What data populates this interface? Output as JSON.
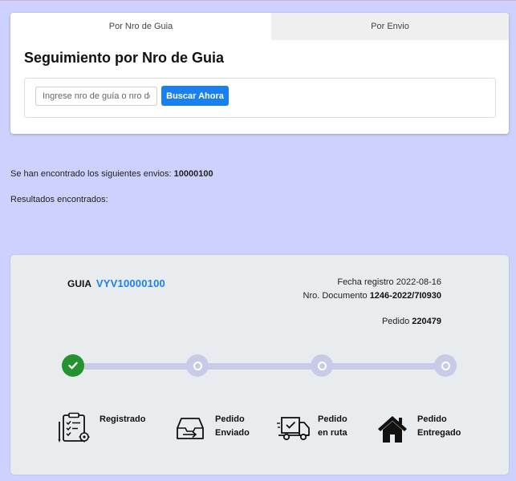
{
  "tabs": [
    {
      "label": "Por Nro de Guia",
      "active": true
    },
    {
      "label": "Por Envio",
      "active": false
    }
  ],
  "search": {
    "title": "Seguimiento por Nro de Guia",
    "placeholder": "Ingrese nro de guía o nro de",
    "value": "",
    "button_label": "Buscar Ahora"
  },
  "results": {
    "found_prefix": "Se han encontrado los siguientes envios:",
    "found_value": "10000100",
    "results_label": "Resultados encontrados:"
  },
  "shipment": {
    "guia_label": "GUIA",
    "guia_number": "VYV10000100",
    "fecha_label": "Fecha registro",
    "fecha_value": "2022-08-16",
    "documento_label": "Nro. Documento",
    "documento_value": "1246-2022/7I0930",
    "pedido_label": "Pedido",
    "pedido_value": "220479"
  },
  "progress": {
    "completed_steps": 1,
    "total_steps": 4,
    "steps": [
      {
        "line1": "Registrado",
        "line2": "",
        "icon": "clipboard-icon",
        "done": true
      },
      {
        "line1": "Pedido",
        "line2": "Enviado",
        "icon": "tray-icon",
        "done": false
      },
      {
        "line1": "Pedido",
        "line2": "en ruta",
        "icon": "truck-icon",
        "done": false
      },
      {
        "line1": "Pedido",
        "line2": "Entregado",
        "icon": "house-icon",
        "done": false
      }
    ]
  },
  "colors": {
    "background": "#cdd1fe",
    "accent": "#1a7ff0",
    "done": "#23922f",
    "track": "#c8cae8"
  }
}
